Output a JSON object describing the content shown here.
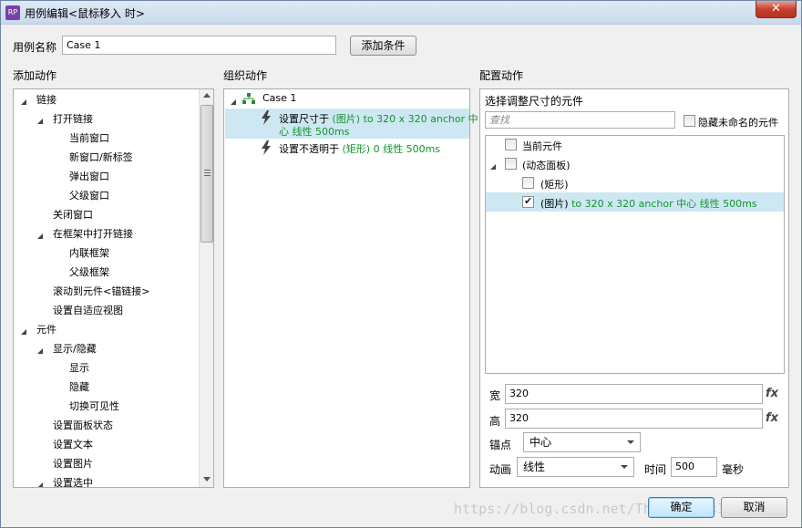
{
  "window": {
    "title": "用例编辑<鼠标移入 时>",
    "app_icon": "RP",
    "close_glyph": "✕"
  },
  "case_name": {
    "label": "用例名称",
    "value": "Case 1"
  },
  "add_condition_button": "添加条件",
  "columns": {
    "add_action": "添加动作",
    "organize_action": "组织动作",
    "configure_action": "配置动作"
  },
  "add_action_tree": [
    {
      "level": 0,
      "expanded": true,
      "label": "链接"
    },
    {
      "level": 1,
      "expanded": true,
      "label": "打开链接"
    },
    {
      "level": 2,
      "label": "当前窗口"
    },
    {
      "level": 2,
      "label": "新窗口/新标签"
    },
    {
      "level": 2,
      "label": "弹出窗口"
    },
    {
      "level": 2,
      "label": "父级窗口"
    },
    {
      "level": 1,
      "label": "关闭窗口"
    },
    {
      "level": 1,
      "expanded": true,
      "label": "在框架中打开链接"
    },
    {
      "level": 2,
      "label": "内联框架"
    },
    {
      "level": 2,
      "label": "父级框架"
    },
    {
      "level": 1,
      "label": "滚动到元件<锚链接>"
    },
    {
      "level": 1,
      "label": "设置自适应视图"
    },
    {
      "level": 0,
      "expanded": true,
      "label": "元件"
    },
    {
      "level": 1,
      "expanded": true,
      "label": "显示/隐藏"
    },
    {
      "level": 2,
      "label": "显示"
    },
    {
      "level": 2,
      "label": "隐藏"
    },
    {
      "level": 2,
      "label": "切换可见性"
    },
    {
      "level": 1,
      "label": "设置面板状态"
    },
    {
      "level": 1,
      "label": "设置文本"
    },
    {
      "level": 1,
      "label": "设置图片"
    },
    {
      "level": 1,
      "expanded": true,
      "label": "设置选中"
    }
  ],
  "organize": {
    "case_label": "Case 1",
    "actions": [
      {
        "prefix": "设置尺寸于 ",
        "detail_line1": "(图片) to 320 x 320 anchor 中",
        "detail_line2": "心 线性 500ms",
        "selected": true
      },
      {
        "prefix": "设置不透明于 ",
        "detail_line1": "(矩形) 0 线性 500ms",
        "detail_line2": "",
        "selected": false
      }
    ]
  },
  "configure": {
    "heading": "选择调整尺寸的元件",
    "search_placeholder": "查找",
    "hide_unnamed_label": "隐藏未命名的元件",
    "targets": [
      {
        "level": 0,
        "checked": false,
        "label": "当前元件",
        "detail": ""
      },
      {
        "level": 0,
        "checked": false,
        "expanded": true,
        "label": "(动态面板)",
        "detail": ""
      },
      {
        "level": 1,
        "checked": false,
        "label": "(矩形)",
        "detail": ""
      },
      {
        "level": 1,
        "checked": true,
        "label": "(图片)",
        "detail": " to 320 x 320 anchor 中心 线性 500ms",
        "selected": true
      }
    ],
    "width_label": "宽",
    "width_value": "320",
    "height_label": "高",
    "height_value": "320",
    "fx": "fx",
    "anchor_label": "锚点",
    "anchor_value": "中心",
    "animation_label": "动画",
    "animation_value": "线性",
    "time_label": "时间",
    "time_value": "500",
    "time_unit": "毫秒"
  },
  "ok_button": "确定",
  "cancel_button": "取消",
  "watermark": "https://blog.csdn.net/TheCheckIsIsCalm"
}
